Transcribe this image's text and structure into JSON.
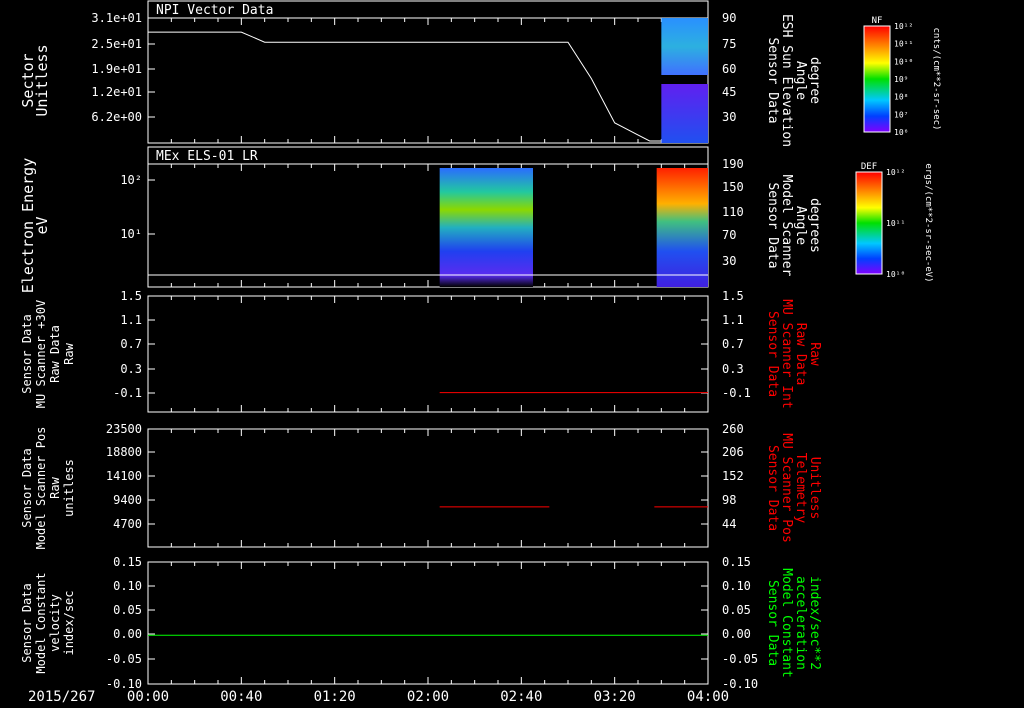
{
  "date_label": "2015/267",
  "time_ticks": [
    "00:00",
    "00:40",
    "01:20",
    "02:00",
    "02:40",
    "03:20",
    "04:00"
  ],
  "chart_data": [
    {
      "type": "line",
      "title": "NPI Vector Data",
      "ylabel": [
        "Sector",
        "Unitless"
      ],
      "y_ticks": [
        "3.1e+01",
        "2.5e+01",
        "1.9e+01",
        "1.2e+01",
        "6.2e+00"
      ],
      "right_ylabel": [
        "Sensor Data",
        "ESH Sun Elevation",
        "Angle",
        "degree"
      ],
      "right_ticks": [
        "90",
        "75",
        "60",
        "45",
        "30"
      ],
      "ylim": [
        0,
        31
      ],
      "series": [
        {
          "color": "#ffffff",
          "x": [
            "00:00",
            "00:40",
            "00:50",
            "02:56",
            "03:00",
            "03:10",
            "03:20",
            "03:35",
            "03:40"
          ],
          "y": [
            27.5,
            27.5,
            25,
            25,
            25,
            16,
            5,
            0.5,
            0.5
          ]
        }
      ],
      "spectrogram_time_range": [
        "03:40",
        "04:00"
      ]
    },
    {
      "type": "heatmap",
      "title": "MEx ELS-01 LR",
      "ylabel": [
        "Electron Energy",
        "eV"
      ],
      "y_ticks": [
        "10²",
        "10¹"
      ],
      "right_ylabel": [
        "Sensor Data",
        "Model Scanner",
        "Angle",
        "degrees"
      ],
      "right_ticks": [
        "190",
        "150",
        "110",
        "70",
        "30"
      ],
      "blocks": [
        {
          "time_range": [
            "02:05",
            "02:45"
          ]
        },
        {
          "time_range": [
            "03:38",
            "04:00"
          ]
        }
      ],
      "series": [
        {
          "color": "#ffffff",
          "x": [
            "00:00",
            "04:00"
          ],
          "y": [
            20,
            20
          ]
        }
      ]
    },
    {
      "type": "line",
      "ylabel": [
        "Sensor Data",
        "MU Scanner +30V",
        "Raw Data",
        "Raw"
      ],
      "y_ticks": [
        "1.5",
        "1.1",
        "0.7",
        "0.3",
        "-0.1"
      ],
      "right_ylabel": [
        "Sensor Data",
        "MU Scanner Int",
        "Raw Data",
        "Raw"
      ],
      "right_ticks": [
        "1.5",
        "1.1",
        "0.7",
        "0.3",
        "-0.1"
      ],
      "ylim": [
        -0.3,
        1.5
      ],
      "series": [
        {
          "color": "#ff0000",
          "x": [
            "02:05",
            "04:00"
          ],
          "y": [
            0,
            0
          ]
        }
      ]
    },
    {
      "type": "line",
      "ylabel": [
        "Sensor Data",
        "Model Scanner Pos",
        "Raw",
        "unitless"
      ],
      "y_ticks": [
        "23500",
        "18800",
        "14100",
        "9400",
        "4700"
      ],
      "right_ylabel": [
        "Sensor Data",
        "MU Scanner Pos",
        "Telemetry",
        "Unitless"
      ],
      "right_ticks": [
        "260",
        "206",
        "152",
        "98",
        "44"
      ],
      "ylim": [
        0,
        23500
      ],
      "series": [
        {
          "color": "#ff0000",
          "x": [
            "02:05",
            "02:52"
          ],
          "y": [
            8000,
            8000
          ]
        },
        {
          "color": "#ff0000",
          "x": [
            "03:37",
            "04:00"
          ],
          "y": [
            8000,
            8000
          ]
        }
      ]
    },
    {
      "type": "line",
      "ylabel": [
        "Sensor Data",
        "Model Constant",
        "velocity",
        "index/sec"
      ],
      "y_ticks": [
        "0.15",
        "0.10",
        "0.05",
        "0.00",
        "-0.05",
        "-0.10"
      ],
      "right_ylabel": [
        "Sensor Data",
        "Model Constant",
        "acceleration",
        "index/sec**2"
      ],
      "right_ticks": [
        "0.15",
        "0.10",
        "0.05",
        "0.00",
        "-0.05",
        "-0.10"
      ],
      "ylim": [
        -0.1,
        0.15
      ],
      "series": [
        {
          "color": "#00ff00",
          "x": [
            "00:00",
            "04:00"
          ],
          "y": [
            0,
            0
          ]
        }
      ]
    }
  ],
  "colorbars": [
    {
      "label": "NF",
      "units": "cnts/(cm**2-sr-sec)",
      "ticks": [
        "10¹²",
        "10¹¹",
        "10¹⁰",
        "10⁹",
        "10⁸",
        "10⁷",
        "10⁶"
      ]
    },
    {
      "label": "DEF",
      "units": "ergs/(cm**2-sr-sec-eV)",
      "ticks": [
        "10¹²",
        "10¹¹",
        "10¹⁰"
      ]
    }
  ],
  "colors": {
    "background": "#000000",
    "axes": "#ffffff",
    "right_label_panel3": "#ff0000",
    "right_label_panel4": "#ff0000",
    "right_label_panel5": "#00ff00"
  }
}
